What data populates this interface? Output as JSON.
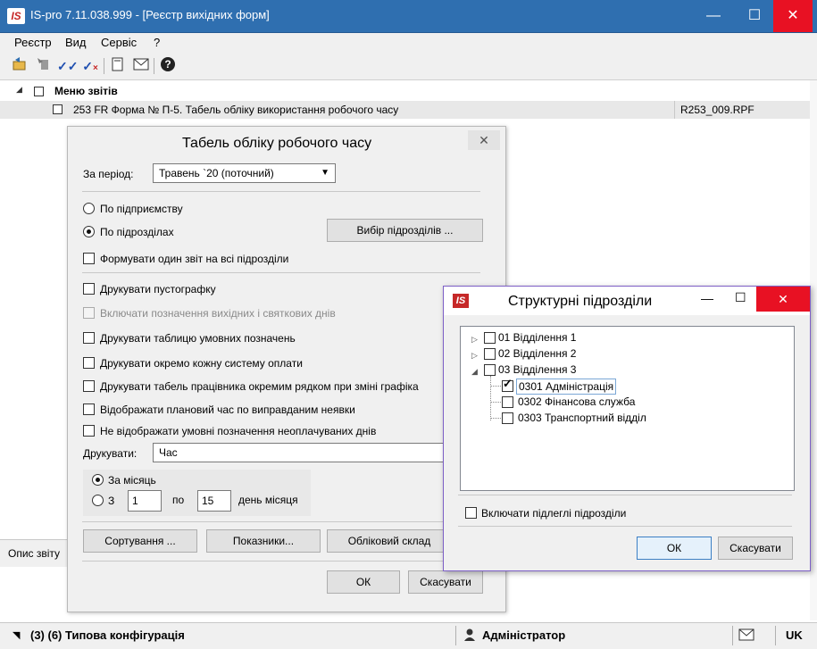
{
  "window": {
    "title": "IS-pro 7.11.038.999 - [Реєстр вихідних форм]",
    "logo": "IS",
    "minimize_icon": "—",
    "maximize_icon": "☐",
    "close_icon": "✕"
  },
  "menubar": [
    "Реєстр",
    "Вид",
    "Сервіс",
    "?"
  ],
  "toolbar_icons": [
    "open-icon",
    "move-icon",
    "check-double-icon",
    "check-cancel-icon",
    "document-icon",
    "mail-icon",
    "help-icon"
  ],
  "tree": {
    "root_label": "Меню звітів",
    "row_label": "253 FR Форма № П-5. Табель обліку використання робочого часу",
    "row_file": "R253_009.RPF"
  },
  "side_tab": "Опис звіту",
  "statusbar": {
    "config": "(3) (6) Типова конфігурація",
    "user": "Адміністратор",
    "lang": "UK"
  },
  "dialog1": {
    "title": "Табель обліку робочого часу",
    "period_label": "За період:",
    "period_value": "Травень `20 (поточний)",
    "radio_enterprise": "По підприємству",
    "radio_divisions": "По підрозділах",
    "choose_divisions_button": "Вибір підрозділів ...",
    "single_report": "Формувати один звіт на всі підрозділи",
    "print_empty_graph": "Друкувати пустографку",
    "include_weekends": "Включати позначення вихідних і святкових днів",
    "print_legend_table": "Друкувати таблицю умовних позначень",
    "print_each_payment": "Друкувати окремо кожну систему оплати",
    "print_employee_row": "Друкувати табель працівника окремим рядком при зміні графіка",
    "show_planned_time": "Відображати плановий час по виправданим неявки",
    "hide_unpaid_marks": "Не відображати умовні позначення неоплачуваних днів",
    "print_label": "Друкувати:",
    "print_value": "Час",
    "per_month": "За місяць",
    "from_label": "З",
    "from_value": "1",
    "to_label": "по",
    "to_value": "15",
    "day_of_month": "день місяця",
    "sort_button": "Сортування ...",
    "indicators_button": "Показники...",
    "accounting_button": "Обліковий склад",
    "ok_button": "ОК",
    "cancel_button": "Скасувати"
  },
  "dialog2": {
    "title": "Структурні підрозділи",
    "logo": "IS",
    "nodes": [
      {
        "label": "01 Відділення 1",
        "checked": false
      },
      {
        "label": "02 Відділення 2",
        "checked": false
      },
      {
        "label": "03 Відділення 3",
        "checked": false
      },
      {
        "label": "0301 Адміністрація",
        "checked": true
      },
      {
        "label": "0302 Фінансова служба",
        "checked": false
      },
      {
        "label": "0303 Транспортний відділ",
        "checked": false
      }
    ],
    "include_sub": "Включати підлеглі підрозділи",
    "ok_button": "ОК",
    "cancel_button": "Скасувати"
  }
}
